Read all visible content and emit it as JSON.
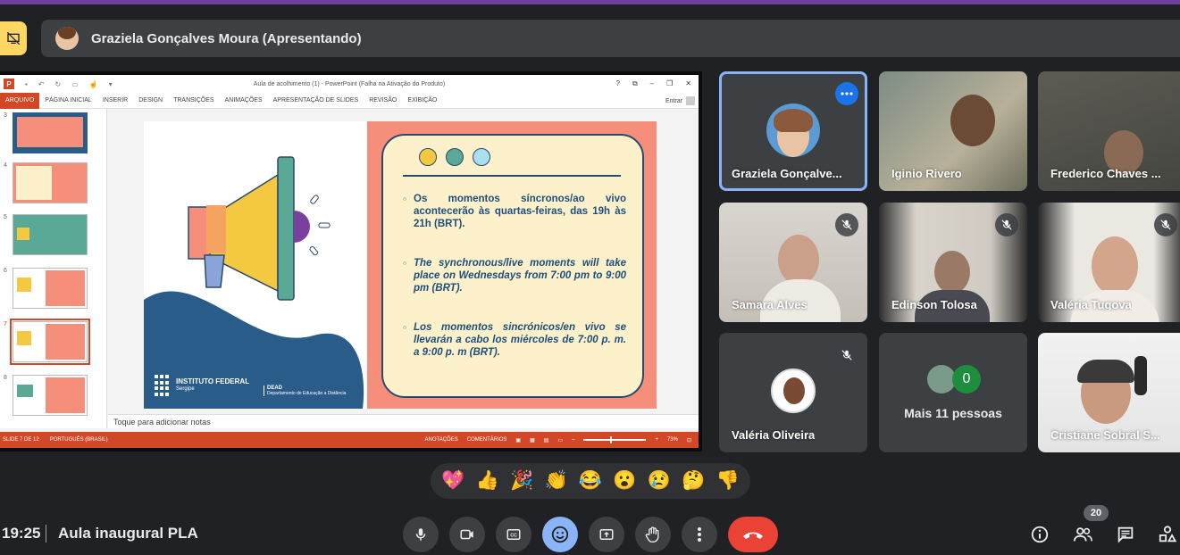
{
  "presenter_bar": {
    "name": "Graziela Gonçalves Moura (Apresentando)"
  },
  "powerpoint": {
    "doc_title": "Aula de acolhimento (1) - PowerPoint (Falha na Ativação do Produto)",
    "window_controls": [
      "?",
      "⧉",
      "–",
      "❐",
      "✕"
    ],
    "ribbon_tabs": [
      "ARQUIVO",
      "PÁGINA INICIAL",
      "INSERIR",
      "DESIGN",
      "TRANSIÇÕES",
      "ANIMAÇÕES",
      "APRESENTAÇÃO DE SLIDES",
      "REVISÃO",
      "EXIBIÇÃO"
    ],
    "signin_label": "Entrar",
    "slide_numbers": [
      "3",
      "4",
      "5",
      "6",
      "7",
      "8"
    ],
    "selected_slide": "7",
    "notes_placeholder": "Toque para adicionar notas",
    "status": {
      "slide_count": "SLIDE 7 DE 12",
      "language": "PORTUGUÊS (BRASIL)",
      "notes_label": "ANOTAÇÕES",
      "comments_label": "COMENTÁRIOS",
      "zoom": "73%"
    },
    "slide": {
      "colors": {
        "background_right": "#f58f7c",
        "card": "#fdf1cc",
        "text": "#1f4e79",
        "dot1": "#f5c842",
        "dot2": "#5aa896",
        "dot3": "#a8e0f0"
      },
      "paragraphs": [
        "Os momentos síncronos/ao vivo acontecerão às quartas-feiras, das 19h às 21h (BRT).",
        "The synchronous/live moments will take place on Wednesdays from 7:00 pm to 9:00 pm (BRT).",
        "Los momentos sincrónicos/en vivo se llevarán a cabo los miércoles de 7:00 p. m. a 9:00 p. m (BRT)."
      ],
      "institution": "INSTITUTO FEDERAL",
      "institution_sub": "Sergipe",
      "dept_code": "DEAD",
      "dept_name": "Departamento de Educação a Distância"
    }
  },
  "participants": [
    {
      "name": "Graziela Gonçalve...",
      "muted": false,
      "speaking": true
    },
    {
      "name": "Iginio Rivero",
      "muted": false
    },
    {
      "name": "Frederico Chaves ...",
      "muted": false
    },
    {
      "name": "Samara Alves",
      "muted": true
    },
    {
      "name": "Edinson Tolosa",
      "muted": true
    },
    {
      "name": "Valéria Tugova",
      "muted": true
    },
    {
      "name": "Valéria Oliveira",
      "muted": true
    },
    {
      "name": "Cristiane Sobral S...",
      "muted": false
    }
  ],
  "more_people": {
    "label": "Mais 11 pessoas",
    "extra_count": "0"
  },
  "reactions": [
    "💖",
    "👍",
    "🎉",
    "👏",
    "😂",
    "😮",
    "😢",
    "🤔",
    "👎"
  ],
  "bottom": {
    "time": "19:25",
    "meeting_name": "Aula inaugural PLA",
    "participant_count": "20"
  },
  "colors": {
    "background": "#202124",
    "tile": "#3c4043",
    "accent_blue": "#8ab4f8",
    "end_call_red": "#ea4335",
    "presenting_yellow": "#fdd663",
    "ppt_orange": "#d24726"
  }
}
